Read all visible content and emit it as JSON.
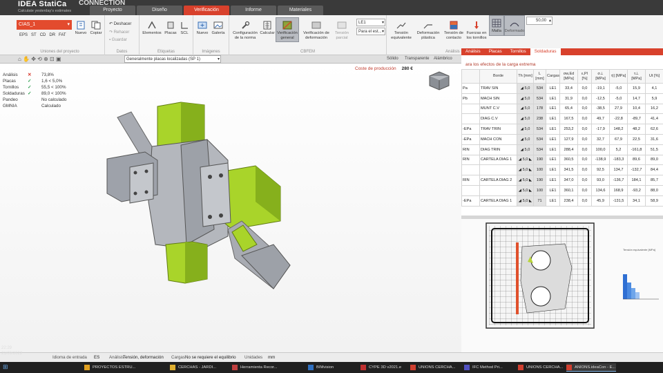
{
  "app": {
    "brand": "IDEA StatiCa",
    "product": "CONNECTION",
    "tagline": "Calculate yesterday's estimates"
  },
  "tabs": [
    "Proyecto",
    "Diseño",
    "Verificación",
    "Informe",
    "Materiales"
  ],
  "active_tab": "Verificación",
  "ribbon": {
    "project": "CIAS_1",
    "mini_tabs": [
      "EPS",
      "ST",
      "CD",
      "DR",
      "FAT"
    ],
    "nuevo": "Nuevo",
    "copiar": "Copiar",
    "group_project": "Uniones del proyecto",
    "deshacer": "Deshacer",
    "rehacer": "Rehacer",
    "guardar": "Guardar",
    "group_datos": "Datos",
    "elementos": "Elementos",
    "placas": "Placas",
    "scl": "SCL",
    "group_etiquetas": "Etiquetas",
    "nuevo2": "Nuevo",
    "galeria": "Galería",
    "group_imagenes": "Imágenes",
    "configuracion": "Configuración de la norma",
    "calcular": "Calcular",
    "verificacion_general": "Verificación general",
    "verificacion_deformacion": "Verificación de deformación",
    "tension_parcial": "Tensión parcial",
    "para_el_est": "Para el est...",
    "group_cbfem": "CBFEM",
    "tension_equivalente": "Tensión equivalente",
    "deformacion_plastica": "Deformación plástica",
    "tension_contacto": "Tensión de contacto",
    "fuerzas_tornillos": "Fuerzas en los tornillos",
    "malla": "Malla",
    "deformado": "Deformado",
    "group_analisis": "Análisis EF",
    "zoom_value": "50,00"
  },
  "viewbar": {
    "load_case": "Generalmente placas localizadas (SP 1)",
    "modes": [
      "Sólido",
      "Transparente",
      "Alámbrico"
    ]
  },
  "summary": [
    {
      "label": "Análisis",
      "mark": "✕",
      "status": "bad",
      "value": "73,8%"
    },
    {
      "label": "Placas",
      "mark": "✓",
      "status": "ok",
      "value": "1,6 < 5,0%"
    },
    {
      "label": "Tornillos",
      "mark": "✓",
      "status": "ok",
      "value": "55,5 < 100%"
    },
    {
      "label": "Soldaduras",
      "mark": "✓",
      "status": "ok",
      "value": "89,0 < 100%"
    },
    {
      "label": "Pandeo",
      "mark": "",
      "status": "none",
      "value": "No calculado"
    },
    {
      "label": "GMNIA",
      "mark": "",
      "status": "none",
      "value": "Calculado"
    }
  ],
  "production_cost": {
    "label": "Coste de producción",
    "value": "280 €"
  },
  "right_panel": {
    "tabs": [
      "Análisis",
      "Placas",
      "Tornillos",
      "Soldaduras"
    ],
    "active_tab": "Soldaduras",
    "title": "ara los efectos de la carga extrema",
    "columns": [
      "",
      "Borde",
      "Th [mm]",
      "L [mm]",
      "Cargas",
      "σw,Ed [MPa]",
      "ε,Pl [%]",
      "σ⊥ [MPa]",
      "τ|| [MPa]",
      "τ⊥ [MPa]",
      "Ut [%]"
    ],
    "rows": [
      [
        "Pa",
        "TRAV SIN",
        "◢ 5,0",
        "534",
        "LE1",
        "33,4",
        "0,0",
        "-19,1",
        "-5,0",
        "15,9",
        "4,1"
      ],
      [
        "Pb",
        "MACH SIN",
        "◢ 5,0",
        "534",
        "LE1",
        "31,9",
        "0,0",
        "-12,5",
        "-5,0",
        "14,7",
        "5,9"
      ],
      [
        "",
        "MUNT C.V",
        "◢ 5,0",
        "178",
        "LE1",
        "65,4",
        "0,0",
        "-38,5",
        "27,9",
        "10,4",
        "16,2"
      ],
      [
        "",
        "DIAG C.V",
        "◢ 5,0",
        "238",
        "LE1",
        "167,5",
        "0,0",
        "49,7",
        "-22,8",
        "-89,7",
        "41,4"
      ],
      [
        "-EPa",
        "TRAV TRIN",
        "◢ 5,0",
        "534",
        "LE1",
        "253,2",
        "0,0",
        "-17,9",
        "148,2",
        "48,2",
        "62,6"
      ],
      [
        "-EPa",
        "MACH CON",
        "◢ 5,0",
        "534",
        "LE1",
        "127,9",
        "0,0",
        "32,7",
        "67,9",
        "22,5",
        "31,6"
      ],
      [
        "RIN",
        "DIAG TRIN",
        "◢ 5,0",
        "534",
        "LE1",
        "288,4",
        "0,0",
        "100,0",
        "5,2",
        "-161,8",
        "51,5"
      ],
      [
        "RIN",
        "CARTELA DIAG 1",
        "◢ 5,0 ◣",
        "190",
        "LE1",
        "360,5",
        "0,0",
        "-138,9",
        "-183,3",
        "89,6",
        "89,0"
      ],
      [
        "",
        "",
        "◢ 5,0 ◣",
        "100",
        "LE1",
        "341,5",
        "0,0",
        "92,5",
        "134,7",
        "-132,7",
        "84,4"
      ],
      [
        "RIN",
        "CARTELA DIAG 2",
        "◢ 5,0 ◣",
        "190",
        "LE1",
        "347,0",
        "0,0",
        "93,0",
        "-136,7",
        "184,1",
        "85,7"
      ],
      [
        "",
        "",
        "◢ 5,0 ◣",
        "100",
        "LE1",
        "360,1",
        "0,0",
        "134,6",
        "168,9",
        "-93,2",
        "88,0"
      ],
      [
        "-EPa",
        "CARTELA DIAG 1",
        "◢ 5,0 ◣",
        "71",
        "LE1",
        "238,4",
        "0,0",
        "45,9",
        "-131,5",
        "34,1",
        "58,9"
      ]
    ]
  },
  "statusbar": {
    "lang_label": "Idioma de entrada",
    "lang": "ES",
    "analysis_label": "Análisis",
    "analysis": "Tensión, deformación",
    "loads_label": "Cargas",
    "loads": "No se requiere el equilibrio",
    "units_label": "Unidades",
    "units": "mm"
  },
  "taskbar": [
    {
      "label": "PROYECTOS ESTRU...",
      "color": "#e0a020"
    },
    {
      "label": "CERCHAS - JARDI...",
      "color": "#e0b030"
    },
    {
      "label": "Herramienta Recor...",
      "color": "#c04040"
    },
    {
      "label": "BIMvision",
      "color": "#3070c0"
    },
    {
      "label": "CYPE 3D v2021.e",
      "color": "#c03030"
    },
    {
      "label": "UNIONS CERCHA...",
      "color": "#d04030"
    },
    {
      "label": "IFC Method Pri...",
      "color": "#5050c0"
    },
    {
      "label": "UNIONS CERCHA...",
      "color": "#d04030"
    },
    {
      "label": "ANIONS.ideaCon - E...",
      "color": "#d04030"
    }
  ],
  "clock": {
    "time": "22:29",
    "date": "21/09/2022"
  },
  "colors": {
    "accent": "#d8412c",
    "member": "#a7d12b",
    "steel": "#9a9ea8"
  }
}
